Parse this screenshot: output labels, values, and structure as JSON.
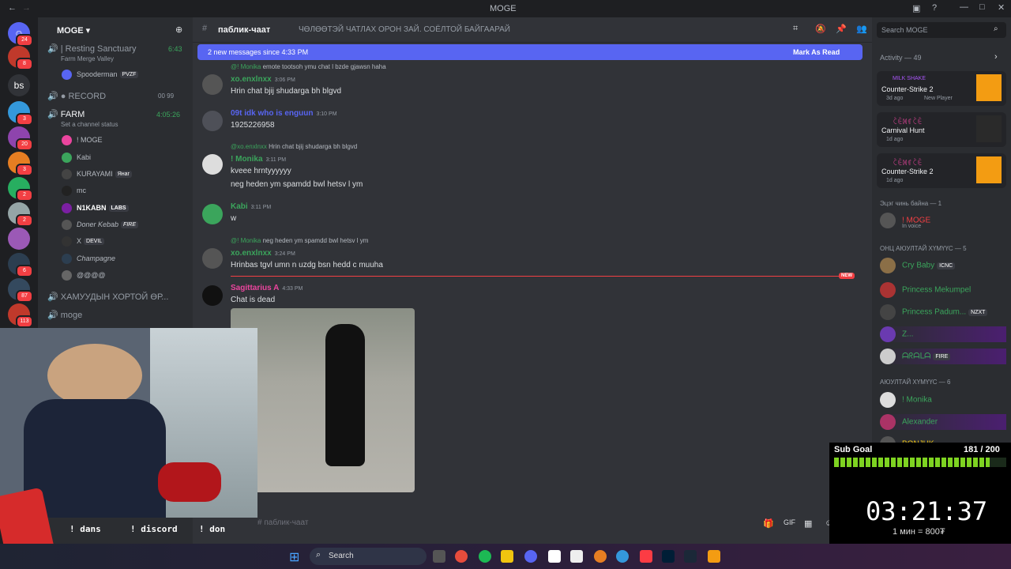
{
  "window": {
    "title": "MOGE"
  },
  "server": {
    "name": "MOGE"
  },
  "channels": [
    {
      "name": "| Resting Sanctuary",
      "time": "6:43",
      "sub": "Farm Merge Valley"
    },
    {
      "name": "RECORD",
      "counts": "00 99"
    },
    {
      "name": "FARM",
      "time": "4:05:26",
      "sub": "Set a channel status"
    },
    {
      "name": "ХАМУУДЫН ХОРТОЙ ӨР..."
    },
    {
      "name": "moge"
    }
  ],
  "voice_users": [
    "Spooderman",
    "! MOGE",
    "Kabi",
    "KURAYAMI",
    "mc",
    "N1KABN",
    "Doner Kebab",
    "X",
    "Champagne",
    "@@@@"
  ],
  "voice_tags": {
    "Spooderman": "PVZF",
    "KURAYAMI": "Янаг",
    "N1KABN": "LABS",
    "Doner Kebab": "FIRE",
    "X": "DEVIL"
  },
  "chat": {
    "channel": "паблик-чаат",
    "topic": "ЧӨЛӨӨТЭЙ ЧАТЛАХ ОРОН ЗАЙ. СОЁЛТОЙ БАЙГААРАЙ",
    "newbar": "2 new messages since 4:33 PM",
    "mark_read": "Mark As Read",
    "input_placeholder": "паблик-чаат",
    "new_label": "NEW"
  },
  "messages": [
    {
      "reply": "@! Monika",
      "reply_text": "emote tootsoh ymu chat l bzde gjawsn haha",
      "user": "xo.enxlnxx",
      "time": "3:06 PM",
      "lines": [
        "Hrin chat bjij shudarga bh blgvd"
      ]
    },
    {
      "user": "09t idk who is enguun",
      "time": "3:10 PM",
      "lines": [
        "1925226958"
      ]
    },
    {
      "reply": "@xo.enxlnxx",
      "reply_text": "Hrin chat bjij shudarga bh blgvd",
      "user": "! Monika",
      "time": "3:11 PM",
      "lines": [
        "kveee hrntyyyyyy",
        "neg heden ym spamdd bwl hetsv l ym"
      ]
    },
    {
      "user": "Kabi",
      "time": "3:11 PM",
      "lines": [
        "w"
      ]
    },
    {
      "reply": "@! Monika",
      "reply_text": "neg heden ym spamdd bwl hetsv l ym",
      "user": "xo.enxlnxx",
      "time": "3:24 PM",
      "lines": [
        "Hrinbas tgvl umn n uzdg bsn hedd c muuha"
      ]
    },
    {
      "user": "Sagittarius A",
      "time": "4:33 PM",
      "lines": [
        "Chat is dead"
      ]
    }
  ],
  "search": {
    "placeholder": "Search MOGE"
  },
  "activity": {
    "header": "Activity — 49",
    "items": [
      {
        "user": "MILK SHAKE",
        "game": "Counter-Strike 2",
        "meta": "3d ago",
        "extra": "New Player"
      },
      {
        "user": "ꉓꍟꁒꁍꉓꍟ",
        "game": "Carnival Hunt",
        "meta": "1d ago"
      },
      {
        "user": "ꉓꍟꁒꁍꉓꍟ",
        "game": "Counter-Strike 2",
        "meta": "1d ago"
      }
    ]
  },
  "member_groups": [
    {
      "title": "Эцэг чинь байна — 1",
      "members": [
        {
          "name": "! MOGE",
          "status": "In voice"
        }
      ]
    },
    {
      "title": "ОНЦ АЮУЛТАЙ ХҮМҮҮС — 5",
      "members": [
        {
          "name": "Cry Baby",
          "tag": "ICNC"
        },
        {
          "name": "Princess Mekumpel"
        },
        {
          "name": "Princess Padum...",
          "tag": "NZXT"
        },
        {
          "name": "Z..."
        },
        {
          "name": "ᗩᖇᗩᒪᗩ",
          "tag": "FIRE"
        }
      ]
    },
    {
      "title": "АЮУЛТАЙ ХҮМҮҮС — 6",
      "members": [
        {
          "name": "! Monika"
        },
        {
          "name": "Alexander"
        },
        {
          "name": "BONJUK"
        }
      ]
    }
  ],
  "overlay": {
    "commands": [
      "! dans",
      "! discord",
      "! don"
    ],
    "sub_goal": "Sub Goal",
    "sub_count": "181 / 200",
    "sub_progress": 0.905,
    "timer": "03:21:37",
    "rate": "1 мин = 800₮"
  },
  "taskbar": {
    "search": "Search"
  },
  "colors": {
    "blurple": "#5865f2",
    "green": "#3ba55c",
    "pink": "#eb459e"
  }
}
